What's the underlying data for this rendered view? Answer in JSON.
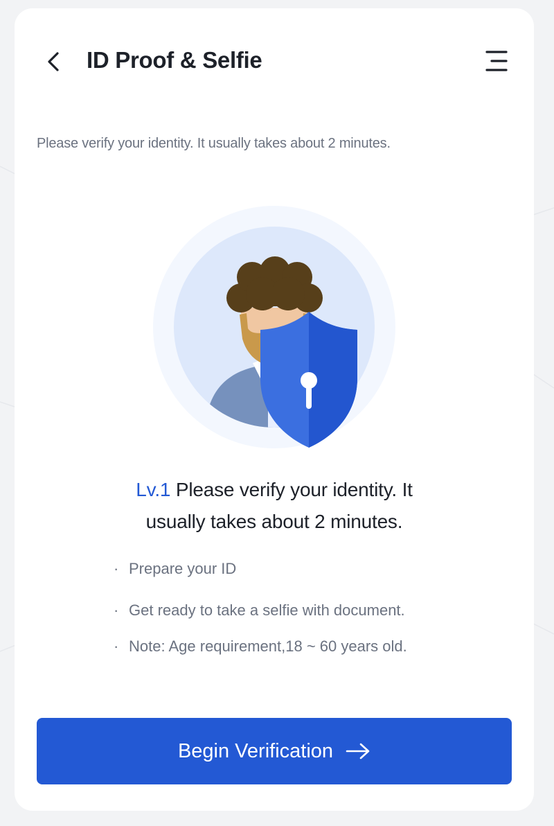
{
  "header": {
    "title": "ID Proof & Selfie",
    "back_icon": "chevron-left-icon",
    "menu_icon": "menu-icon"
  },
  "intro": {
    "text": "Please verify your identity. It usually takes about 2 minutes."
  },
  "illustration": {
    "icon": "user-avatar-with-shield-illustration"
  },
  "headline": {
    "level": "Lv.1",
    "text_line1": " Please verify your identity. It",
    "text_line2": "usually takes about 2 minutes."
  },
  "requirements": [
    "Prepare your ID",
    "Get ready to take a selfie with document.",
    "Note: Age requirement,18 ~ 60 years old."
  ],
  "cta": {
    "label": "Begin Verification",
    "icon": "arrow-right-icon"
  },
  "colors": {
    "accent": "#2359d4",
    "title": "#1d2129",
    "muted": "#6b7280",
    "background": "#f2f3f5",
    "card": "#ffffff"
  }
}
